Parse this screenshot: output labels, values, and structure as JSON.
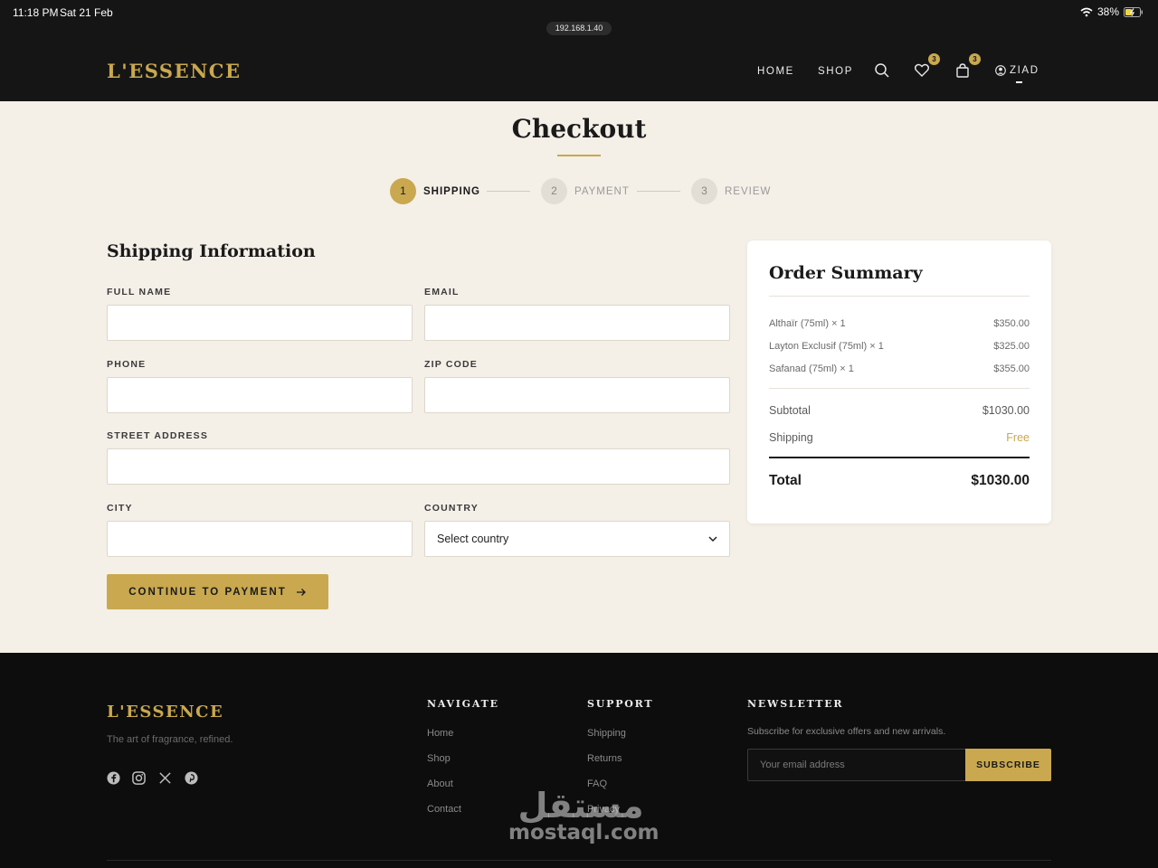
{
  "status_bar": {
    "time": "11:18 PM",
    "date": "Sat 21 Feb",
    "battery": "38%",
    "url": "192.168.1.40"
  },
  "header": {
    "logo": "L'ESSENCE",
    "nav": [
      "HOME",
      "SHOP"
    ],
    "wishlist_count": "3",
    "cart_count": "3",
    "user_name": "ZIAD"
  },
  "page": {
    "title": "Checkout"
  },
  "steps": [
    {
      "number": "1",
      "label": "SHIPPING",
      "active": true
    },
    {
      "number": "2",
      "label": "PAYMENT",
      "active": false
    },
    {
      "number": "3",
      "label": "REVIEW",
      "active": false
    }
  ],
  "form": {
    "section_title": "Shipping Information",
    "labels": {
      "full_name": "FULL NAME",
      "email": "EMAIL",
      "phone": "PHONE",
      "zip": "ZIP CODE",
      "street": "STREET ADDRESS",
      "city": "CITY",
      "country": "COUNTRY"
    },
    "country_selected": "Select country",
    "submit_label": "CONTINUE TO PAYMENT"
  },
  "summary": {
    "title": "Order Summary",
    "items": [
      {
        "name": "Althaïr (75ml) × 1",
        "price": "$350.00"
      },
      {
        "name": "Layton Exclusif (75ml) × 1",
        "price": "$325.00"
      },
      {
        "name": "Safanad (75ml) × 1",
        "price": "$355.00"
      }
    ],
    "subtotal_label": "Subtotal",
    "subtotal_value": "$1030.00",
    "shipping_label": "Shipping",
    "shipping_value": "Free",
    "total_label": "Total",
    "total_value": "$1030.00"
  },
  "footer": {
    "logo": "L'ESSENCE",
    "tagline": "The art of fragrance, refined.",
    "navigate_heading": "NAVIGATE",
    "navigate_links": [
      "Home",
      "Shop",
      "About",
      "Contact"
    ],
    "support_heading": "SUPPORT",
    "support_links": [
      "Shipping",
      "Returns",
      "FAQ",
      "Privacy"
    ],
    "newsletter_heading": "NEWSLETTER",
    "newsletter_text": "Subscribe for exclusive offers and new arrivals.",
    "email_placeholder": "Your email address",
    "subscribe_label": "SUBSCRIBE"
  },
  "watermark": {
    "arabic": "مستقل",
    "latin": "mostaql.com"
  },
  "colors": {
    "gold": "#c9a84f",
    "dark": "#151515",
    "cream": "#f4efe7"
  }
}
